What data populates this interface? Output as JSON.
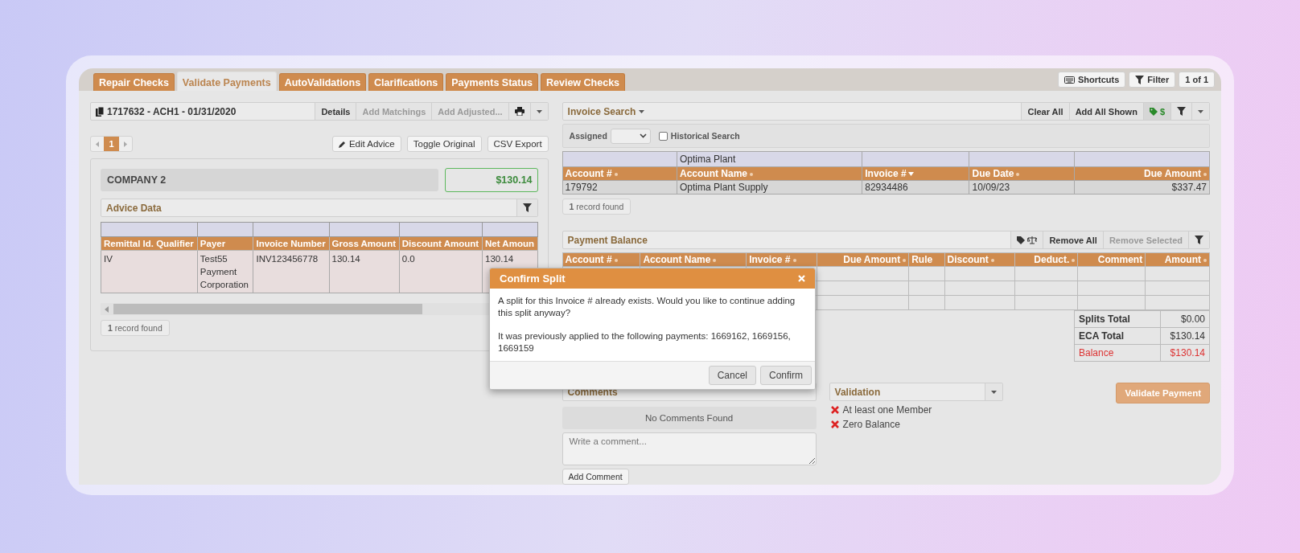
{
  "tabs": [
    {
      "label": "Repair Checks",
      "selected": false
    },
    {
      "label": "Validate Payments",
      "selected": true
    },
    {
      "label": "AutoValidations",
      "selected": false
    },
    {
      "label": "Clarifications",
      "selected": false
    },
    {
      "label": "Payments Status",
      "selected": false
    },
    {
      "label": "Review Checks",
      "selected": false
    }
  ],
  "top_tools": {
    "shortcuts": "Shortcuts",
    "filter": "Filter",
    "page_count": "1 of 1"
  },
  "check_header": {
    "title": "1717632 - ACH1 - 01/31/2020",
    "buttons": [
      {
        "label": "Details",
        "disabled": false
      },
      {
        "label": "Add Matchings",
        "disabled": true
      },
      {
        "label": "Add Adjusted...",
        "disabled": true
      }
    ]
  },
  "pager": {
    "pages": [
      {
        "label": "1",
        "selected": true
      }
    ]
  },
  "advice_buttons": [
    {
      "label": "Edit Advice",
      "kind": "edit"
    },
    {
      "label": "Toggle Original",
      "kind": "plain"
    },
    {
      "label": "CSV Export",
      "kind": "plain"
    }
  ],
  "company": {
    "name": "COMPANY 2",
    "amount": "$130.14"
  },
  "advice_data": {
    "title": "Advice Data",
    "columns": [
      "Remittal Id. Qualifier",
      "Payer",
      "Invoice Number",
      "Gross Amount",
      "Discount Amount",
      "Net Amoun"
    ],
    "rows": [
      [
        "IV",
        "Test55 Payment Corporation",
        "INV123456778",
        "130.14",
        "0.0",
        "130.14"
      ]
    ],
    "record_count": "**1** record found"
  },
  "invoice_search": {
    "title": "Invoice Search",
    "buttons": [
      "Clear All",
      "Add All Shown"
    ],
    "tag_button": "$",
    "assigned_label": "Assigned",
    "historical_search": {
      "label": "Historical Search",
      "checked": false
    },
    "columns": [
      {
        "label": "Account #",
        "sortable": true,
        "sorted": false
      },
      {
        "label": "Account Name",
        "sortable": true,
        "sorted": false,
        "filter": "Optima Plant"
      },
      {
        "label": "Invoice #",
        "sortable": true,
        "sorted": true
      },
      {
        "label": "Due Date",
        "sortable": true,
        "sorted": false
      },
      {
        "label": "Due Amount",
        "sortable": true,
        "sorted": false
      }
    ],
    "rows": [
      [
        "179792",
        "Optima Plant Supply",
        "82934486",
        "10/09/23",
        "$337.47"
      ]
    ],
    "record_count": "**1** record found"
  },
  "payment_balance": {
    "title": "Payment Balance",
    "buttons": [
      {
        "label": "Remove All",
        "disabled": false
      },
      {
        "label": "Remove Selected",
        "disabled": true
      }
    ],
    "columns": [
      {
        "label": "Account #",
        "sortable": true,
        "sorted": false
      },
      {
        "label": "Account Name",
        "sortable": true,
        "sorted": false
      },
      {
        "label": "Invoice #",
        "sortable": true,
        "sorted": false
      },
      {
        "label": "Due Amount",
        "sortable": true,
        "sorted": false
      },
      {
        "label": "Rule",
        "sortable": false
      },
      {
        "label": "Discount",
        "sortable": true,
        "sorted": false
      },
      {
        "label": "Deduct.",
        "sortable": true,
        "sorted": false
      },
      {
        "label": "Comment",
        "sortable": false
      },
      {
        "label": "Amount",
        "sortable": true,
        "sorted": false
      }
    ],
    "totals": [
      {
        "label": "Splits Total",
        "value": "$0.00",
        "alert": false
      },
      {
        "label": "ECA Total",
        "value": "$130.14",
        "alert": false
      },
      {
        "label": "Balance",
        "value": "$130.14",
        "alert": true
      }
    ]
  },
  "comments": {
    "title": "Comments",
    "empty_text": "No Comments Found",
    "placeholder": "Write a comment...",
    "button": "Add Comment"
  },
  "validation": {
    "title": "Validation",
    "items": [
      {
        "label": "At least one Member",
        "passed": false
      },
      {
        "label": "Zero Balance",
        "passed": false
      }
    ]
  },
  "validate_button": {
    "label": "Validate Payment",
    "disabled": true
  },
  "dialog": {
    "title": "Confirm Split",
    "paragraphs": [
      "A split for this Invoice # already exists. Would you like to continue adding this split anyway?",
      "It was previously applied to the following payments: 1669162, 1669156, 1669159"
    ],
    "buttons": [
      "Cancel",
      "Confirm"
    ]
  }
}
